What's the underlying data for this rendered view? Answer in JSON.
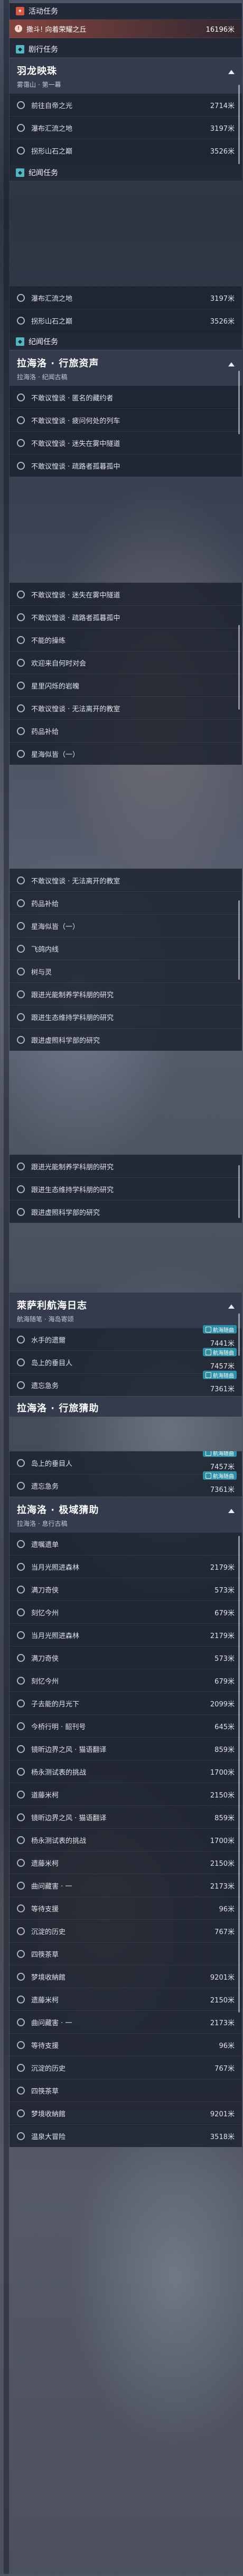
{
  "event": {
    "section_label": "活动任务",
    "section_icon": "event-icon",
    "active_title": "撒斗! 向着荣耀之丘",
    "active_distance": "16196米"
  },
  "story": {
    "section_label": "剧行任务",
    "head_title": "羽龙映珠",
    "head_sub": "雾霭山 · 第一幕",
    "items": [
      {
        "text": "前往自帝之光",
        "dist": "2714米"
      },
      {
        "text": "瀑布汇流之地",
        "dist": "3197米"
      },
      {
        "text": "拐形山石之巅",
        "dist": "3526米"
      }
    ]
  },
  "panel2": {
    "section_label": "纪闻任务",
    "items": [
      {
        "text": "拐形山石之巅",
        "dist": "3526米"
      }
    ]
  },
  "main_quest": {
    "section_label": "纪闻任务",
    "title": "拉海洛 · 行旅资声",
    "subtitle": "拉海洛 · 纪闻古稿"
  },
  "groups": [
    [
      "不敢议惶谈 · 匿名的藏约者",
      "不敢议惶谈 · 疲问何处的列车",
      "不敢议惶谈 · 迷失在雾中隧道",
      "不敢议惶谈 · 疏路者孤暮孤中"
    ],
    [
      "不敢议惶谈 · 迷失在雾中隧道",
      "不敢议惶谈 · 疏路者孤暮孤中",
      "不能的操练",
      "欢迎来自何时对会",
      "星里闪烁的岩魄",
      "不敢议惶谈 · 无法离开的教室",
      "药品补给",
      "星海似皆（一）"
    ],
    [
      "不敢议惶谈 · 无法离开的教室",
      "药品补给",
      "星海似皆（一）",
      "飞鸽内线",
      "树与灵",
      "跟进光能制养学科朋的研究",
      "跟进生态维持学科朋的研究",
      "跟进虚照科学部的研究"
    ],
    [
      "跟进光能制养学科朋的研究",
      "跟进生态维持学科朋的研究",
      "跟进虚照科学部的研究"
    ]
  ],
  "voyage": {
    "title": "萊萨利航海日志",
    "subtitle": "航海随笔 · 海岛寄颂",
    "tag_label": "航海随曲",
    "items": [
      {
        "text": "水手的遗爾",
        "dist": "7441米"
      },
      {
        "text": "岛上的垂目人",
        "dist": "7457米"
      },
      {
        "text": "遗忘急务",
        "dist": "7361米"
      }
    ],
    "partial_title": "拉海洛 · 行旅猜助",
    "items2": [
      {
        "text": "岛上的垂目人",
        "dist": "7457米"
      },
      {
        "text": "遗忘急务",
        "dist": "7361米"
      }
    ]
  },
  "final": {
    "title": "拉海洛 · 极域猜助",
    "subtitle": "拉海洛 · 息行古稿",
    "items": [
      {
        "text": "遗嘱遗单",
        "dist": ""
      },
      {
        "text": "当月光照进森林",
        "dist": "2179米"
      },
      {
        "text": "满刀奇侠",
        "dist": "573米"
      },
      {
        "text": "刻忆今州",
        "dist": "679米"
      },
      {
        "text": "当月光照进森林",
        "dist": "2179米"
      },
      {
        "text": "满刀奇侠",
        "dist": "573米"
      },
      {
        "text": "刻忆今州",
        "dist": "679米"
      },
      {
        "text": "子去能的月光下",
        "dist": "2099米"
      },
      {
        "text": "今桥行明 · 韶刊号",
        "dist": "645米"
      },
      {
        "text": "镜昕边界之风 · 猫语翻译",
        "dist": "859米"
      },
      {
        "text": "杨永测试表的挑战",
        "dist": "1700米"
      },
      {
        "text": "道藤米柯",
        "dist": "2150米"
      },
      {
        "text": "镜昕边界之风 · 猫语翻译",
        "dist": "859米"
      },
      {
        "text": "杨永测试表的挑战",
        "dist": "1700米"
      },
      {
        "text": "遗藤米柯",
        "dist": "2150米"
      },
      {
        "text": "曲问藏害 · 一",
        "dist": "2173米"
      },
      {
        "text": "等待支援",
        "dist": "96米"
      },
      {
        "text": "沉淀的历史",
        "dist": "767米"
      },
      {
        "text": "四筷茶草",
        "dist": ""
      },
      {
        "text": "梦境收納館",
        "dist": "9201米"
      },
      {
        "text": "遗藤米柯",
        "dist": "2150米"
      },
      {
        "text": "曲问藏害 · 一",
        "dist": "2173米"
      },
      {
        "text": "等待支援",
        "dist": "96米"
      },
      {
        "text": "沉淀的历史",
        "dist": "767米"
      },
      {
        "text": "四筷茶草",
        "dist": ""
      },
      {
        "text": "梦境收納館",
        "dist": "9201米"
      },
      {
        "text": "温泉大冒险",
        "dist": "3518米"
      }
    ]
  }
}
